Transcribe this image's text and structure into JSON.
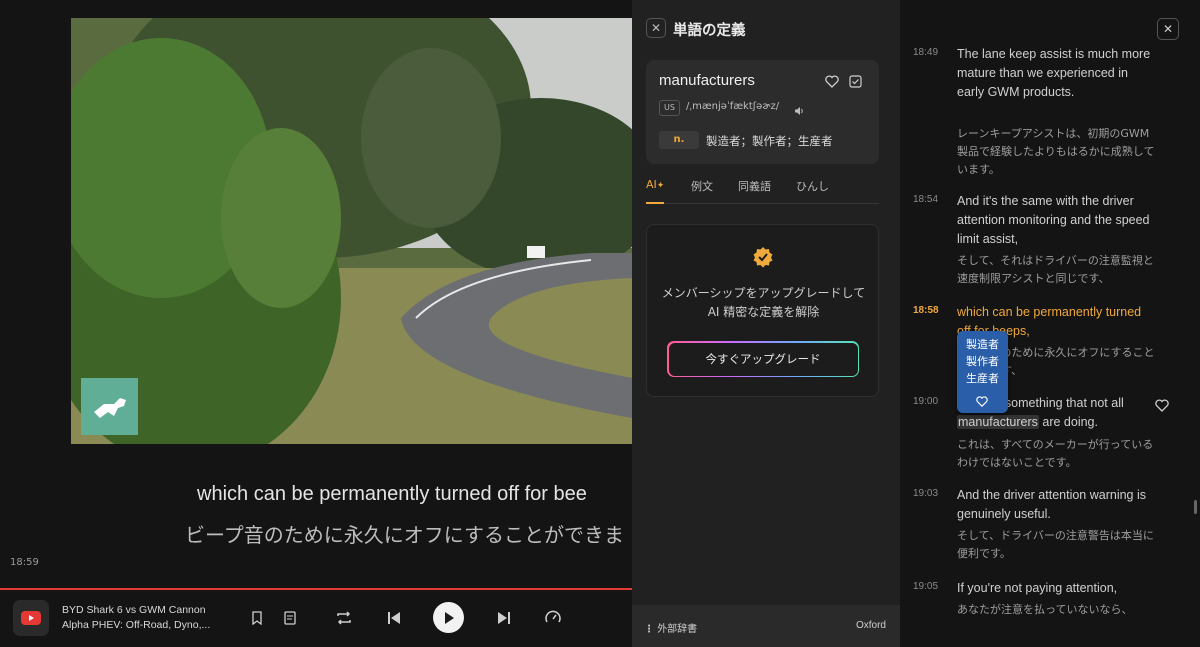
{
  "player": {
    "subtitle_en": "which can be permanently turned off for bee",
    "subtitle_ja": "ビープ音のために永久にオフにすることができま",
    "current_time": "18:59",
    "title_line1": "BYD Shark 6 vs GWM Cannon",
    "title_line2": "Alpha PHEV: Off-Road, Dyno,..."
  },
  "dictionary": {
    "title": "単語の定義",
    "word": "manufacturers",
    "region": "US",
    "ipa": "/ˌmænjəˈfæktʃəɚz/",
    "pos": "n.",
    "meaning": "製造者；製作者；生産者",
    "tabs": [
      "AI",
      "例文",
      "同義語",
      "ひんし"
    ],
    "upgrade_text": "メンバーシップをアップグレードして AI 精密な定義を解除",
    "upgrade_button": "今すぐアップグレード",
    "footer_left": "外部辞書",
    "footer_right": "Oxford"
  },
  "transcript": [
    {
      "time": "18:49",
      "en": "The lane keep assist is much more mature than we experienced in early GWM products.",
      "ja": "レーンキープアシストは、初期のGWM製品で経験したよりもはるかに成熟しています。"
    },
    {
      "time": "18:54",
      "en": "And it's the same with the driver attention monitoring and the speed limit assist,",
      "ja": "そして、それはドライバーの注意監視と速度制限アシストと同じです、"
    },
    {
      "time": "18:58",
      "en": "which can be permanently turned off for beeps,",
      "ja": "ビープ音のために永久にオフにすることができます、"
    },
    {
      "time": "19:00",
      "en_before": "which is something that not all",
      "en_word": "manufacturers",
      "en_after": " are doing.",
      "ja": "これは、すべてのメーカーが行っているわけではないことです。"
    },
    {
      "time": "19:03",
      "en": "And the driver attention warning is genuinely useful.",
      "ja": "そして、ドライバーの注意警告は本当に便利です。"
    },
    {
      "time": "19:05",
      "en": "If you're not paying attention,",
      "ja": "あなたが注意を払っていないなら、"
    }
  ],
  "popup": {
    "meanings": [
      "製造者",
      "製作者",
      "生産者"
    ]
  }
}
